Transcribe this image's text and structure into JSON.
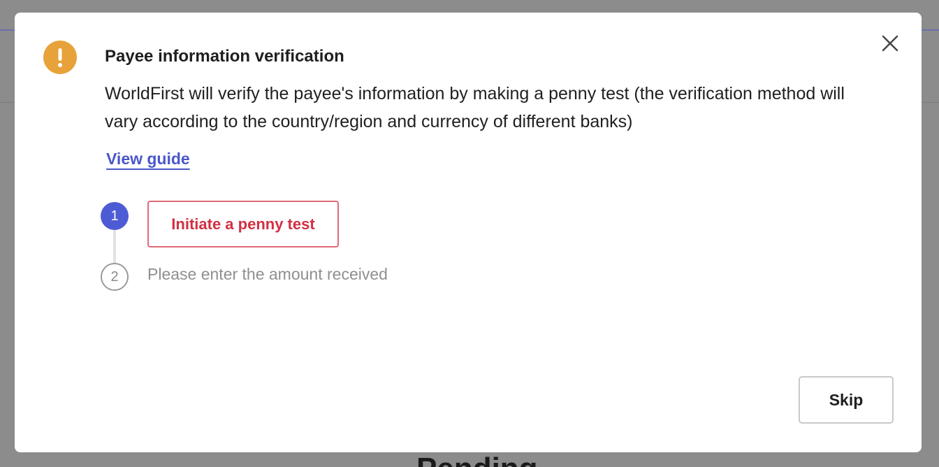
{
  "background": {
    "heading": "Pending"
  },
  "modal": {
    "icon": "warning-exclamation-icon",
    "title": "Payee information verification",
    "description": "WorldFirst will verify the payee's information by making a penny test (the verification method will vary according to the country/region and currency of different banks)",
    "guide_link": "View guide",
    "close_icon": "close-icon",
    "steps": [
      {
        "number": "1",
        "label": "Initiate a penny test",
        "state": "active"
      },
      {
        "number": "2",
        "label": "Please enter the amount received",
        "state": "pending"
      }
    ],
    "skip_label": "Skip"
  },
  "colors": {
    "warning": "#e8a23a",
    "accent": "#4d5bd4",
    "link": "#4a57c9",
    "danger": "#d12f43"
  }
}
